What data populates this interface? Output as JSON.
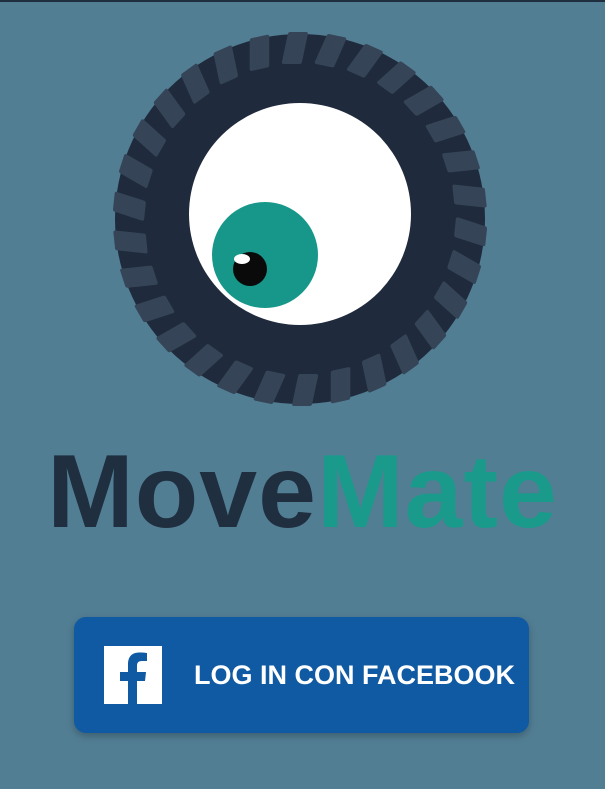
{
  "app": {
    "brand_part_1": "Move",
    "brand_part_2": "Mate"
  },
  "login": {
    "facebook_label": "LOG IN CON FACEBOOK"
  },
  "icons": {
    "logo": "eye-in-tire-logo-icon",
    "facebook": "facebook-logo-icon"
  },
  "colors": {
    "background": "#527e94",
    "brand_dark": "#1f2f40",
    "brand_teal": "#1a9a8a",
    "facebook_blue": "#0f5aa3"
  }
}
